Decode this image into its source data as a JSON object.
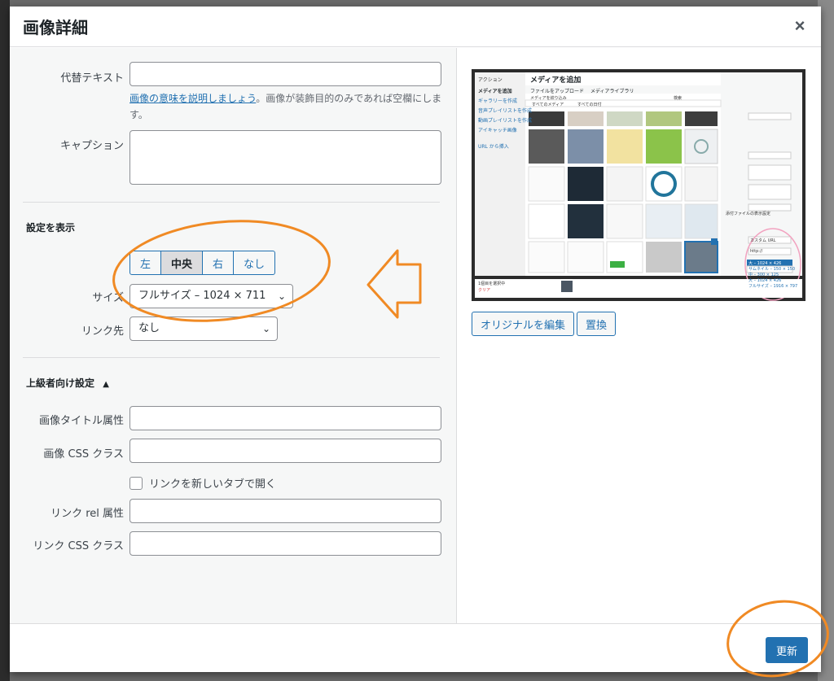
{
  "modal": {
    "title": "画像詳細",
    "close_symbol": "×"
  },
  "fields": {
    "alt_label": "代替テキスト",
    "alt_value": "",
    "alt_help_link": "画像の意味を説明しましょう",
    "alt_help_text": "。画像が装飾目的のみであれば空欄にします。",
    "caption_label": "キャプション",
    "caption_value": ""
  },
  "display": {
    "section_title": "設定を表示",
    "align_options": [
      "左",
      "中央",
      "右",
      "なし"
    ],
    "align_selected": "中央",
    "size_label": "サイズ",
    "size_value": "フルサイズ – 1024 × 711",
    "link_label": "リンク先",
    "link_value": "なし"
  },
  "advanced": {
    "section_title": "上級者向け設定",
    "toggle_symbol": "▲",
    "title_attr_label": "画像タイトル属性",
    "css_class_label": "画像 CSS クラス",
    "new_tab_label": "リンクを新しいタブで開く",
    "rel_label": "リンク rel 属性",
    "link_css_label": "リンク CSS クラス"
  },
  "preview": {
    "edit_original_label": "オリジナルを編集",
    "replace_label": "置換",
    "inner": {
      "sidebar_title": "アクション",
      "sidebar_items": [
        "メディアを追加",
        "ギャラリーを作成",
        "音声プレイリストを作成",
        "動画プレイリストを作成",
        "アイキャッチ画像",
        "URL から挿入"
      ],
      "panel_title": "メディアを追加",
      "tabs": [
        "ファイルをアップロード",
        "メディアライブラリ"
      ],
      "filter_label": "メディアを絞り込み",
      "filter_media": "すべてのメディア",
      "filter_date": "すべての日付",
      "search_label": "検索",
      "selected_count": "1個目を選択中",
      "clear_label": "クリア",
      "attach_title": "添付ファイルの表示設定",
      "link_value": "カスタム URL",
      "url_value": "http://",
      "size_current": "大 – 1024 × 426",
      "size_options": [
        "サムネイル – 150 × 150",
        "中 – 300 × 125",
        "大 – 1024 × 426",
        "フルサイズ – 1916 × 797"
      ]
    }
  },
  "footer": {
    "update_label": "更新"
  },
  "colors": {
    "primary": "#2271b1",
    "annotation": "#f08a24"
  }
}
